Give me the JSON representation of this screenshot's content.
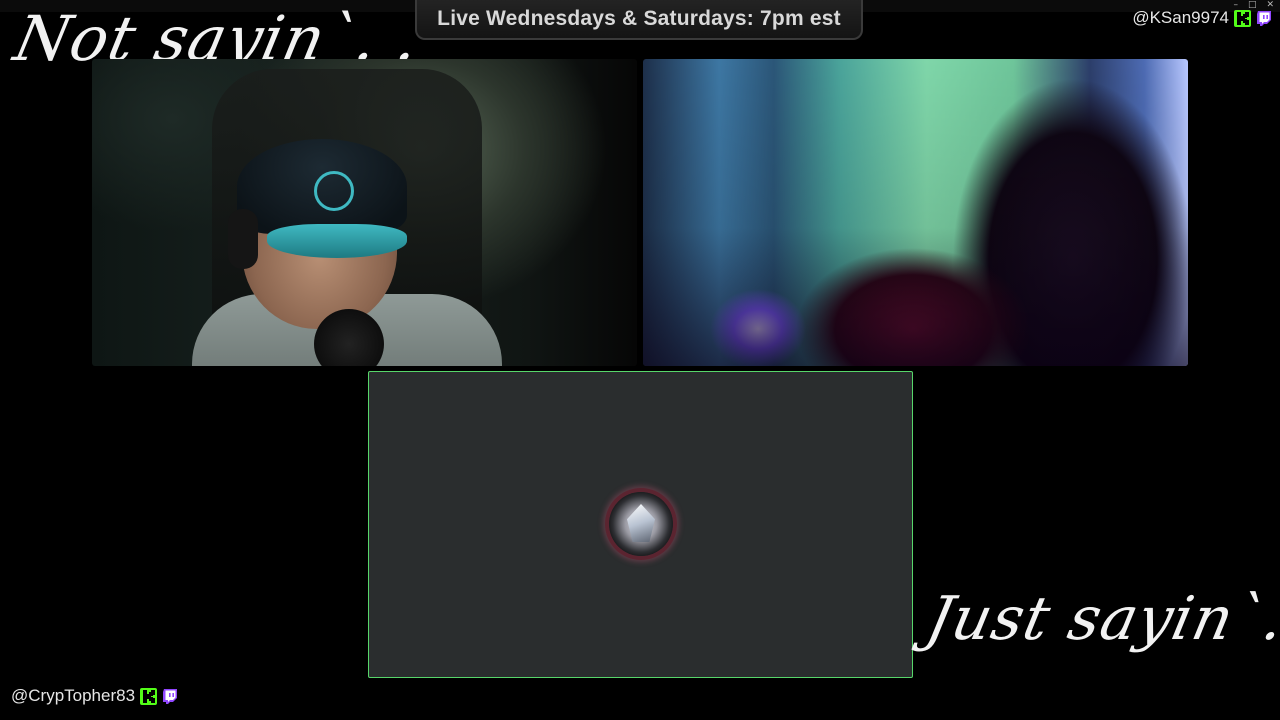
{
  "banner": {
    "text": "Live Wednesdays & Saturdays: 7pm est"
  },
  "top_handle": {
    "username": "@KSan9974"
  },
  "bottom_handle": {
    "username": "@CrypTopher83"
  },
  "overlay_text": {
    "top_left": "Not sayin`. .",
    "bottom_right": "Just sayin`. ."
  },
  "icons": {
    "kick": "kick-logo-icon",
    "twitch": "twitch-logo-icon"
  },
  "colors": {
    "background": "#000000",
    "kick_green": "#53fc18",
    "twitch_purple": "#9146ff",
    "active_speaker_border": "#57d66a",
    "empty_tile": "#2a2d2e"
  }
}
